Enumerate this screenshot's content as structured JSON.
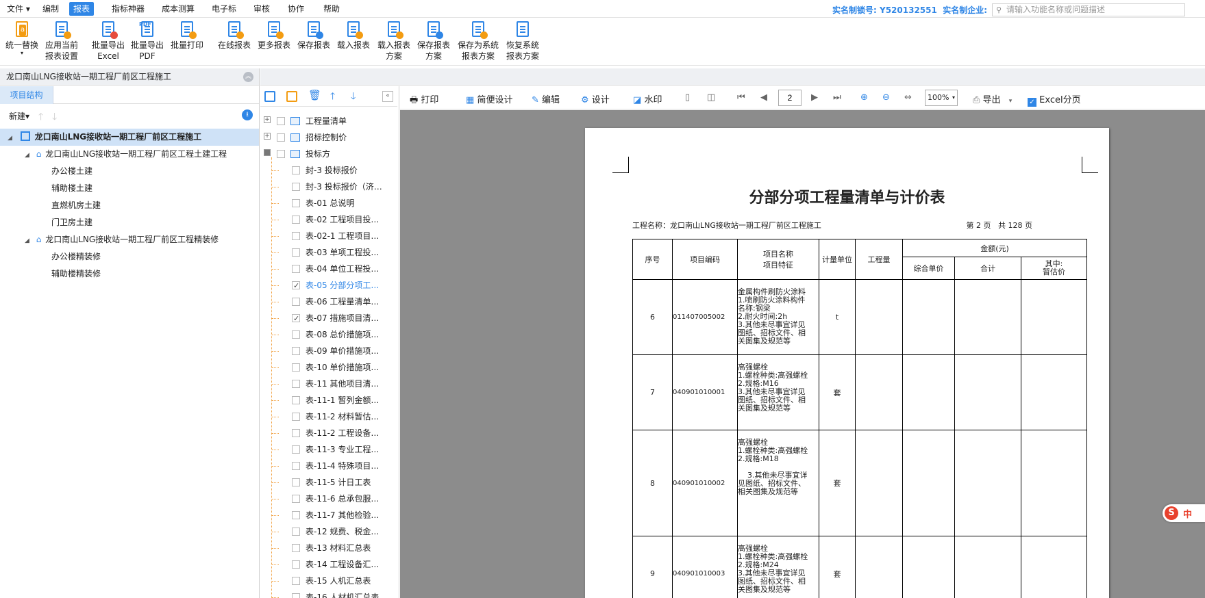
{
  "menubar": {
    "items": [
      "文件",
      "编制",
      "报表",
      "指标神器",
      "成本测算",
      "电子标",
      "审核",
      "协作",
      "帮助"
    ],
    "active": "报表",
    "license_label": "实名制锁号:",
    "license_value": "Y520132551",
    "company_label": "实名制企业:",
    "search_placeholder": "请输入功能名称或问题描述"
  },
  "ribbon": {
    "buttons": [
      "统一替换",
      "应用当前\n报表设置",
      "批量导出\nExcel",
      "批量导出\nPDF",
      "批量打印",
      "在线报表",
      "更多报表",
      "保存报表",
      "载入报表",
      "载入报表\n方案",
      "保存报表\n方案",
      "保存为系统\n报表方案",
      "恢复系统\n报表方案"
    ]
  },
  "left_pane": {
    "title": "龙口南山LNG接收站一期工程厂前区工程施工",
    "tab": "项目结构",
    "new_label": "新建",
    "tree": [
      {
        "label": "龙口南山LNG接收站一期工程厂前区工程施工",
        "level": 0,
        "kind": "building-icon"
      },
      {
        "label": "龙口南山LNG接收站一期工程厂前区工程土建工程",
        "level": 1,
        "kind": "home-icon"
      },
      {
        "label": "办公楼土建",
        "level": 2
      },
      {
        "label": "辅助楼土建",
        "level": 2
      },
      {
        "label": "直燃机房土建",
        "level": 2
      },
      {
        "label": "门卫房土建",
        "level": 2
      },
      {
        "label": "龙口南山LNG接收站一期工程厂前区工程精装修",
        "level": 1,
        "kind": "home-icon"
      },
      {
        "label": "办公楼精装修",
        "level": 2
      },
      {
        "label": "辅助楼精装修",
        "level": 2
      }
    ]
  },
  "report_list": {
    "groups": [
      {
        "label": "工程量清单",
        "expander": "+"
      },
      {
        "label": "招标控制价",
        "expander": "+"
      },
      {
        "label": "投标方",
        "expander": "-"
      }
    ],
    "items": [
      {
        "label": "封-3  投标报价",
        "checked": false
      },
      {
        "label": "封-3  投标报价（济…",
        "checked": false
      },
      {
        "label": "表-01 总说明",
        "checked": false
      },
      {
        "label": "表-02 工程项目投…",
        "checked": false
      },
      {
        "label": "表-02-1 工程项目…",
        "checked": false
      },
      {
        "label": "表-03 单项工程投…",
        "checked": false
      },
      {
        "label": "表-04 单位工程投…",
        "checked": false
      },
      {
        "label": "表-05 分部分项工…",
        "checked": true,
        "active": true
      },
      {
        "label": "表-06 工程量清单…",
        "checked": false
      },
      {
        "label": "表-07 措施项目清…",
        "checked": true
      },
      {
        "label": "表-08 总价措施项…",
        "checked": false
      },
      {
        "label": "表-09 单价措施项…",
        "checked": false
      },
      {
        "label": "表-10 单价措施项…",
        "checked": false
      },
      {
        "label": "表-11 其他项目清…",
        "checked": false
      },
      {
        "label": "表-11-1 暂列金额…",
        "checked": false
      },
      {
        "label": "表-11-2 材料暂估…",
        "checked": false
      },
      {
        "label": "表-11-2 工程设备…",
        "checked": false
      },
      {
        "label": "表-11-3 专业工程…",
        "checked": false
      },
      {
        "label": "表-11-4 特殊项目…",
        "checked": false
      },
      {
        "label": "表-11-5 计日工表",
        "checked": false
      },
      {
        "label": "表-11-6 总承包服…",
        "checked": false
      },
      {
        "label": "表-11-7 其他检验…",
        "checked": false
      },
      {
        "label": "表-12 规费、税金…",
        "checked": false
      },
      {
        "label": "表-13 材料汇总表",
        "checked": false
      },
      {
        "label": "表-14 工程设备汇…",
        "checked": false
      },
      {
        "label": "表-15 人机汇总表",
        "checked": false
      },
      {
        "label": "表-16 人材机汇总表",
        "checked": false
      }
    ]
  },
  "viewer_toolbar": {
    "print": "打印",
    "simple_design": "简便设计",
    "edit": "编辑",
    "design": "设计",
    "watermark": "水印",
    "page": "2",
    "zoom": "100%",
    "export": "导出",
    "excel_paging": "Excel分页"
  },
  "report": {
    "title": "分部分项工程量清单与计价表",
    "project_label": "工程名称：龙口南山LNG接收站一期工程厂前区工程施工",
    "page_info": "第 2 页   共 128 页",
    "headers": {
      "seq": "序号",
      "code": "项目编码",
      "name": "项目名称",
      "feature": "项目特征",
      "unit": "计量单位",
      "qty": "工程量",
      "amount": "金额(元)",
      "unit_price": "综合单价",
      "total": "合计",
      "of_which": "其中:",
      "provisional": "暂估价"
    },
    "rows": [
      {
        "seq": "6",
        "code": "011407005002",
        "feature": [
          "金属构件刷防火涂料",
          "1.喷刷防火涂料构件",
          "名称:钢梁",
          "2.耐火时间:2h",
          "3.其他未尽事宜详见",
          "图纸、招标文件、相",
          "关图集及规范等"
        ],
        "unit": "t"
      },
      {
        "seq": "7",
        "code": "040901010001",
        "feature": [
          "高强螺栓",
          "1.螺栓种类:高强螺栓",
          "2.规格:M16",
          "3.其他未尽事宜详见",
          "图纸、招标文件、相",
          "关图集及规范等"
        ],
        "unit": "套"
      },
      {
        "seq": "8",
        "code": "040901010002",
        "feature": [
          "高强螺栓",
          "1.螺栓种类:高强螺栓",
          "2.规格:M18",
          "",
          "    3.其他未尽事宜详",
          "见图纸、招标文件、",
          "相关图集及规范等"
        ],
        "unit": "套"
      },
      {
        "seq": "9",
        "code": "040901010003",
        "feature": [
          "高强螺栓",
          "1.螺栓种类:高强螺栓",
          "2.规格:M24",
          "3.其他未尽事宜详见",
          "图纸、招标文件、相",
          "关图集及规范等"
        ],
        "unit": "套"
      }
    ]
  },
  "ime": {
    "label": "中"
  }
}
